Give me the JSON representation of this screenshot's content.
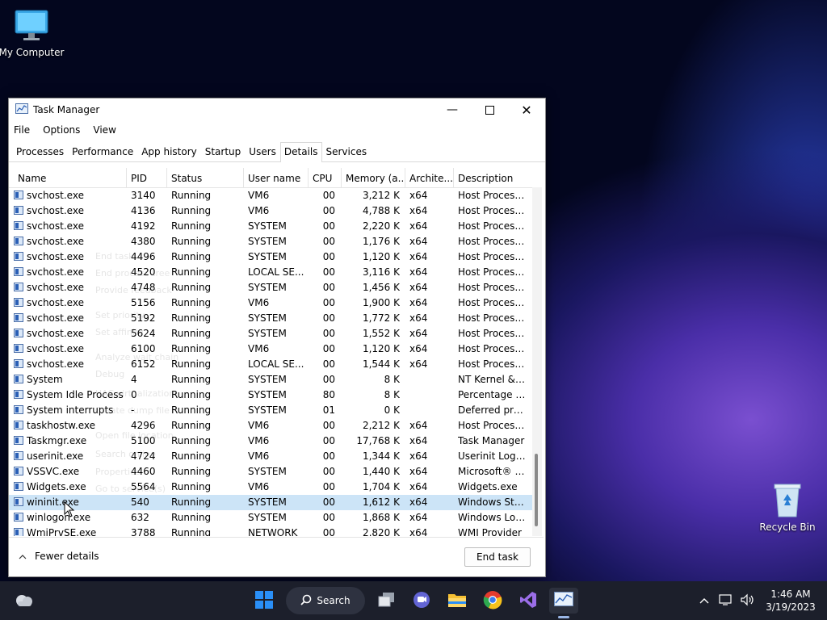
{
  "desktop": {
    "icons": [
      {
        "label": "My Computer",
        "icon": "monitor-icon"
      },
      {
        "label": "Recycle Bin",
        "icon": "recycle-bin-icon"
      }
    ]
  },
  "window": {
    "title": "Task Manager",
    "menu": [
      "File",
      "Options",
      "View"
    ],
    "tabs": [
      "Processes",
      "Performance",
      "App history",
      "Startup",
      "Users",
      "Details",
      "Services"
    ],
    "active_tab": "Details",
    "columns": [
      "Name",
      "PID",
      "Status",
      "User name",
      "CPU",
      "Memory (a...",
      "Archite...",
      "Description"
    ],
    "sort_indicator": "^",
    "rows": [
      {
        "name": "svchost.exe",
        "pid": "3140",
        "status": "Running",
        "user": "VM6",
        "cpu": "00",
        "mem": "3,212 K",
        "arch": "x64",
        "desc": "Host Process ..."
      },
      {
        "name": "svchost.exe",
        "pid": "4136",
        "status": "Running",
        "user": "VM6",
        "cpu": "00",
        "mem": "4,788 K",
        "arch": "x64",
        "desc": "Host Process ..."
      },
      {
        "name": "svchost.exe",
        "pid": "4192",
        "status": "Running",
        "user": "SYSTEM",
        "cpu": "00",
        "mem": "2,220 K",
        "arch": "x64",
        "desc": "Host Process ..."
      },
      {
        "name": "svchost.exe",
        "pid": "4380",
        "status": "Running",
        "user": "SYSTEM",
        "cpu": "00",
        "mem": "1,176 K",
        "arch": "x64",
        "desc": "Host Process ..."
      },
      {
        "name": "svchost.exe",
        "pid": "4496",
        "status": "Running",
        "user": "SYSTEM",
        "cpu": "00",
        "mem": "1,120 K",
        "arch": "x64",
        "desc": "Host Process ..."
      },
      {
        "name": "svchost.exe",
        "pid": "4520",
        "status": "Running",
        "user": "LOCAL SE...",
        "cpu": "00",
        "mem": "3,116 K",
        "arch": "x64",
        "desc": "Host Process ..."
      },
      {
        "name": "svchost.exe",
        "pid": "4748",
        "status": "Running",
        "user": "SYSTEM",
        "cpu": "00",
        "mem": "1,456 K",
        "arch": "x64",
        "desc": "Host Process ..."
      },
      {
        "name": "svchost.exe",
        "pid": "5156",
        "status": "Running",
        "user": "VM6",
        "cpu": "00",
        "mem": "1,900 K",
        "arch": "x64",
        "desc": "Host Process ..."
      },
      {
        "name": "svchost.exe",
        "pid": "5192",
        "status": "Running",
        "user": "SYSTEM",
        "cpu": "00",
        "mem": "1,772 K",
        "arch": "x64",
        "desc": "Host Process ..."
      },
      {
        "name": "svchost.exe",
        "pid": "5624",
        "status": "Running",
        "user": "SYSTEM",
        "cpu": "00",
        "mem": "1,552 K",
        "arch": "x64",
        "desc": "Host Process ..."
      },
      {
        "name": "svchost.exe",
        "pid": "6100",
        "status": "Running",
        "user": "VM6",
        "cpu": "00",
        "mem": "1,120 K",
        "arch": "x64",
        "desc": "Host Process ..."
      },
      {
        "name": "svchost.exe",
        "pid": "6152",
        "status": "Running",
        "user": "LOCAL SE...",
        "cpu": "00",
        "mem": "1,544 K",
        "arch": "x64",
        "desc": "Host Process ..."
      },
      {
        "name": "System",
        "pid": "4",
        "status": "Running",
        "user": "SYSTEM",
        "cpu": "00",
        "mem": "8 K",
        "arch": "",
        "desc": "NT Kernel & S..."
      },
      {
        "name": "System Idle Process",
        "pid": "0",
        "status": "Running",
        "user": "SYSTEM",
        "cpu": "80",
        "mem": "8 K",
        "arch": "",
        "desc": "Percentage of..."
      },
      {
        "name": "System interrupts",
        "pid": "-",
        "status": "Running",
        "user": "SYSTEM",
        "cpu": "01",
        "mem": "0 K",
        "arch": "",
        "desc": "Deferred proc..."
      },
      {
        "name": "taskhostw.exe",
        "pid": "4296",
        "status": "Running",
        "user": "VM6",
        "cpu": "00",
        "mem": "2,212 K",
        "arch": "x64",
        "desc": "Host Process ..."
      },
      {
        "name": "Taskmgr.exe",
        "pid": "5100",
        "status": "Running",
        "user": "VM6",
        "cpu": "00",
        "mem": "17,768 K",
        "arch": "x64",
        "desc": "Task Manager"
      },
      {
        "name": "userinit.exe",
        "pid": "4724",
        "status": "Running",
        "user": "VM6",
        "cpu": "00",
        "mem": "1,344 K",
        "arch": "x64",
        "desc": "Userinit Logo..."
      },
      {
        "name": "VSSVC.exe",
        "pid": "4460",
        "status": "Running",
        "user": "SYSTEM",
        "cpu": "00",
        "mem": "1,440 K",
        "arch": "x64",
        "desc": "Microsoft® V..."
      },
      {
        "name": "Widgets.exe",
        "pid": "5564",
        "status": "Running",
        "user": "VM6",
        "cpu": "00",
        "mem": "1,704 K",
        "arch": "x64",
        "desc": "Widgets.exe"
      },
      {
        "name": "wininit.exe",
        "pid": "540",
        "status": "Running",
        "user": "SYSTEM",
        "cpu": "00",
        "mem": "1,612 K",
        "arch": "x64",
        "desc": "Windows Star...",
        "selected": true
      },
      {
        "name": "winlogon.exe",
        "pid": "632",
        "status": "Running",
        "user": "SYSTEM",
        "cpu": "00",
        "mem": "1,868 K",
        "arch": "x64",
        "desc": "Windows Log..."
      },
      {
        "name": "WmiPrvSE.exe",
        "pid": "3788",
        "status": "Running",
        "user": "NETWORK",
        "cpu": "00",
        "mem": "2,820 K",
        "arch": "x64",
        "desc": "WMI Provider"
      }
    ],
    "fewer_details": "Fewer details",
    "end_task": "End task",
    "ghost_menu": [
      "End task",
      "End process tree",
      "Provide feedback",
      "Set priority",
      "Set affinity",
      "Analyze wait chain",
      "Debug",
      "UAC virtualization",
      "Create dump file",
      "Open file location",
      "Search online",
      "Properties",
      "Go to service(s)"
    ]
  },
  "taskbar": {
    "search_label": "Search",
    "time": "1:46 AM",
    "date": "3/19/2023"
  },
  "colors": {
    "selected_row": "#cce4f7",
    "taskbar": "#1c1f2b",
    "windows_blue": "#2a8ff7"
  }
}
